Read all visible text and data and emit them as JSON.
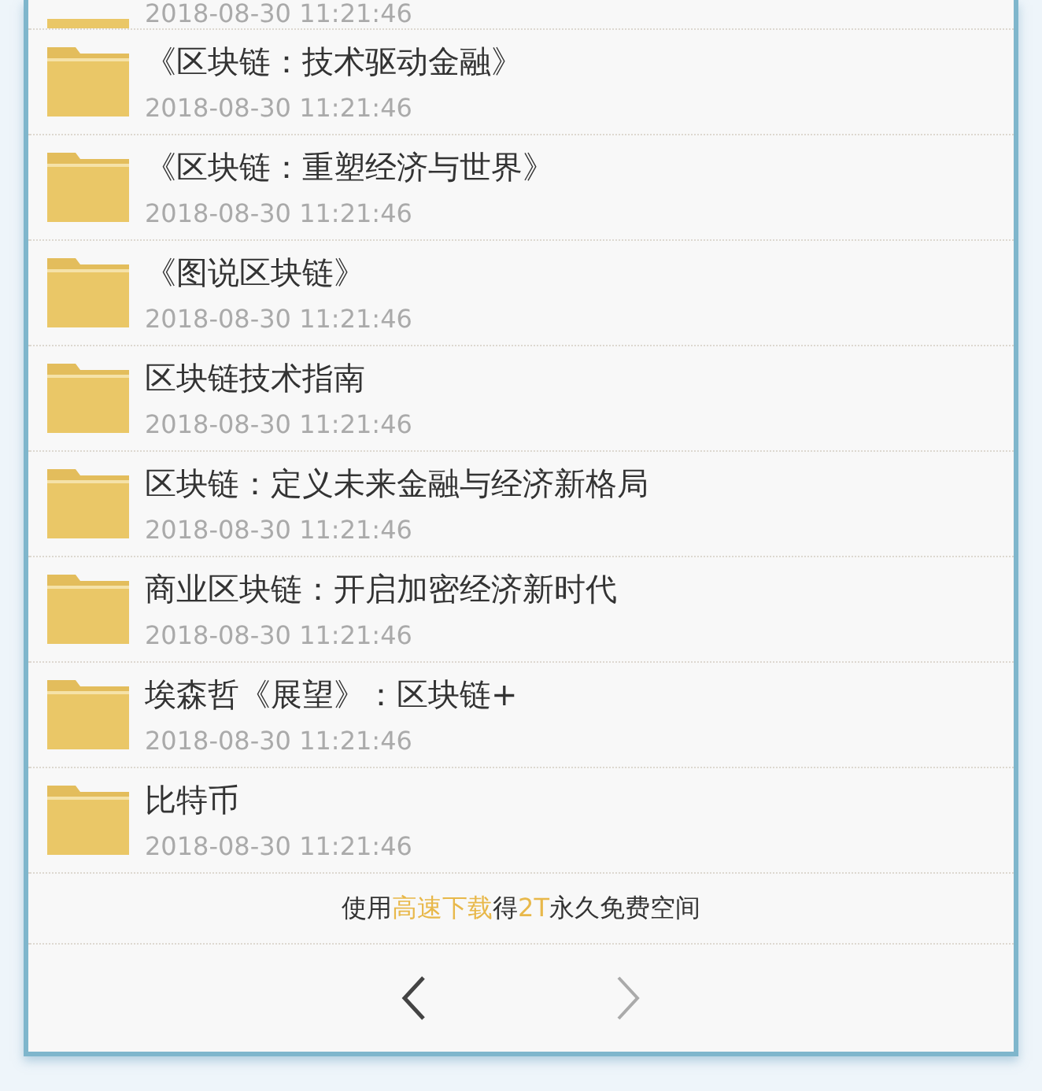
{
  "partial_row": {
    "date": "2018-08-30 11:21:46"
  },
  "files": [
    {
      "name": "《区块链：技术驱动金融》",
      "date": "2018-08-30 11:21:46"
    },
    {
      "name": "《区块链：重塑经济与世界》",
      "date": "2018-08-30 11:21:46"
    },
    {
      "name": "《图说区块链》",
      "date": "2018-08-30 11:21:46"
    },
    {
      "name": "区块链技术指南",
      "date": "2018-08-30 11:21:46"
    },
    {
      "name": "区块链：定义未来金融与经济新格局",
      "date": "2018-08-30 11:21:46"
    },
    {
      "name": "商业区块链：开启加密经济新时代",
      "date": "2018-08-30 11:21:46"
    },
    {
      "name": "埃森哲《展望》：区块链+",
      "date": "2018-08-30 11:21:46"
    },
    {
      "name": "比特币",
      "date": "2018-08-30 11:21:46"
    }
  ],
  "promo": [
    {
      "text": "使用",
      "highlight": false
    },
    {
      "text": "高速下载",
      "highlight": true
    },
    {
      "text": "得",
      "highlight": false
    },
    {
      "text": "2T",
      "highlight": true
    },
    {
      "text": "永久免费空间",
      "highlight": false
    }
  ],
  "pagination": {
    "prev_disabled": false,
    "next_disabled": true
  }
}
